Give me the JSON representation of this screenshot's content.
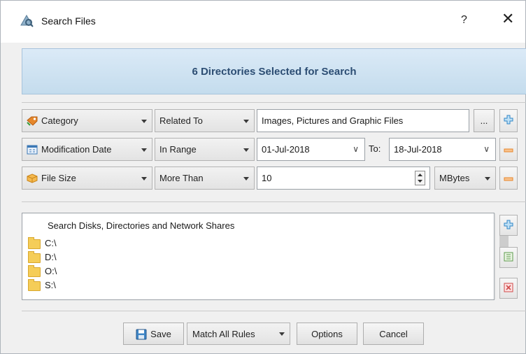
{
  "window": {
    "title": "Search Files",
    "help_label": "?",
    "close_label": "✕"
  },
  "banner": {
    "text": "6 Directories Selected for Search"
  },
  "rules": [
    {
      "field": "Category",
      "field_icon": "category-icon",
      "operator": "Related To",
      "value": "Images, Pictures and Graphic Files",
      "browse_label": "...",
      "action_icon": "plus-icon"
    },
    {
      "field": "Modification Date",
      "field_icon": "calendar-icon",
      "operator": "In Range",
      "from": "01-Jul-2018",
      "to_label": "To:",
      "to": "18-Jul-2018",
      "action_icon": "minus-icon"
    },
    {
      "field": "File Size",
      "field_icon": "size-icon",
      "operator": "More Than",
      "value": "10",
      "unit": "MBytes",
      "action_icon": "minus-icon"
    }
  ],
  "locations": {
    "header": "Search Disks, Directories and Network Shares",
    "items": [
      "C:\\",
      "D:\\",
      "O:\\",
      "S:\\"
    ]
  },
  "footer": {
    "save_label": "Save",
    "match_label": "Match All Rules",
    "options_label": "Options",
    "cancel_label": "Cancel"
  },
  "colors": {
    "accent_blue": "#2c4d73",
    "plus": "#2f86c8",
    "minus": "#e8862a"
  }
}
